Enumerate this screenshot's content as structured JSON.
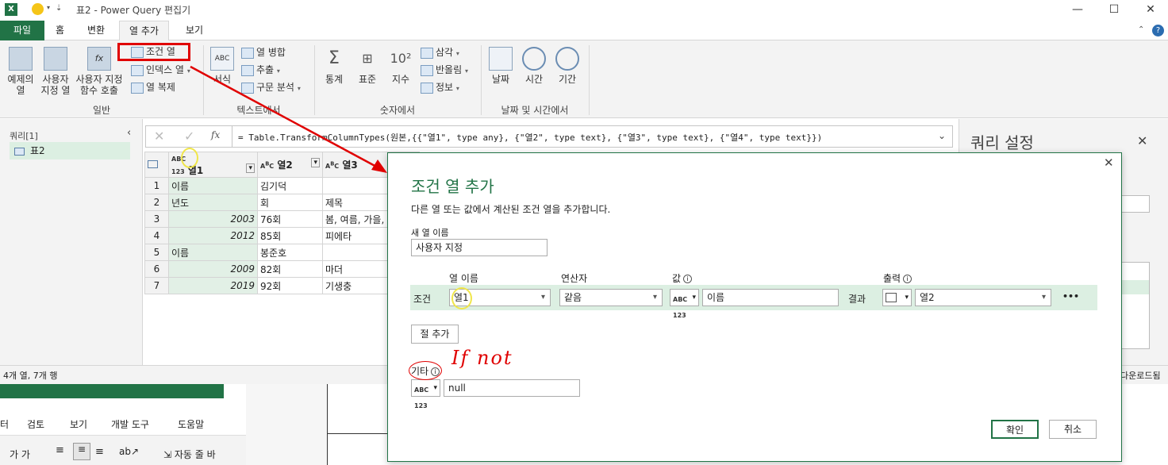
{
  "window": {
    "title": "표2 - Power Query 편집기",
    "minimize": "—",
    "maximize": "☐",
    "close": "✕"
  },
  "tabs": [
    "파일",
    "홈",
    "변환",
    "열 추가",
    "보기"
  ],
  "ribbon": {
    "general": {
      "example_col": "예제의\n열",
      "custom_col": "사용자\n지정 열",
      "invoke_fn": "사용자 지정\n함수 호출",
      "conditional_col": "조건 열",
      "index_col": "인덱스 열",
      "duplicate_col": "열 복제",
      "label": "일반"
    },
    "text": {
      "format": "서식",
      "merge_cols": "열 병합",
      "extract": "추출",
      "parse": "구문 분석",
      "label": "텍스트에서"
    },
    "number": {
      "statistics": "통계",
      "standard": "표준",
      "scientific": "지수",
      "trig": "삼각",
      "rounding": "반올림",
      "info": "정보",
      "label": "숫자에서"
    },
    "datetime": {
      "date": "날짜",
      "time": "시간",
      "duration": "기간",
      "label": "날짜 및 시간에서"
    }
  },
  "queries": {
    "header": "쿼리[1]",
    "items": [
      "표2"
    ]
  },
  "formula": "= Table.TransformColumnTypes(원본,{{\"열1\", type any}, {\"열2\", type text}, {\"열3\", type text}, {\"열4\", type text}})",
  "grid": {
    "columns": [
      "열1",
      "열2",
      "열3"
    ],
    "rows": [
      {
        "n": "1",
        "c1": "이름",
        "c2": "김기덕",
        "c3": ""
      },
      {
        "n": "2",
        "c1": "년도",
        "c2": "회",
        "c3": "제목"
      },
      {
        "n": "3",
        "c1": "2003",
        "c2": "76회",
        "c3": "봄, 여름, 가을, 겨울 ..."
      },
      {
        "n": "4",
        "c1": "2012",
        "c2": "85회",
        "c3": "피에타"
      },
      {
        "n": "5",
        "c1": "이름",
        "c2": "봉준호",
        "c3": ""
      },
      {
        "n": "6",
        "c1": "2009",
        "c2": "82회",
        "c3": "마더"
      },
      {
        "n": "7",
        "c1": "2019",
        "c2": "92회",
        "c3": "기생충"
      }
    ]
  },
  "settings": {
    "title": "쿼리 설정"
  },
  "status": {
    "left": "4개 열, 7개 행",
    "right": "다운로드됨"
  },
  "excel": {
    "tabs": [
      "터",
      "검토",
      "보기",
      "개발 도구",
      "도움말"
    ],
    "wrap": "자동 줄 바"
  },
  "dialog": {
    "title": "조건 열 추가",
    "subtitle": "다른 열 또는 값에서 계산된 조건 열을 추가합니다.",
    "new_col_label": "새 열 이름",
    "new_col_value": "사용자 지정",
    "hdr_col": "열 이름",
    "hdr_op": "연산자",
    "hdr_val": "값",
    "hdr_out": "출력",
    "cond_label": "조건",
    "cond_col": "열1",
    "cond_op": "같음",
    "cond_val": "이름",
    "result_label": "결과",
    "out_val": "열2",
    "more": "•••",
    "add_clause": "절 추가",
    "else_label": "기타",
    "else_val": "null",
    "ok": "확인",
    "cancel": "취소",
    "annotation": "If not"
  },
  "colors": {
    "excel_green": "#217346",
    "highlight_red": "#e00000",
    "row_green": "#dcefe2"
  }
}
